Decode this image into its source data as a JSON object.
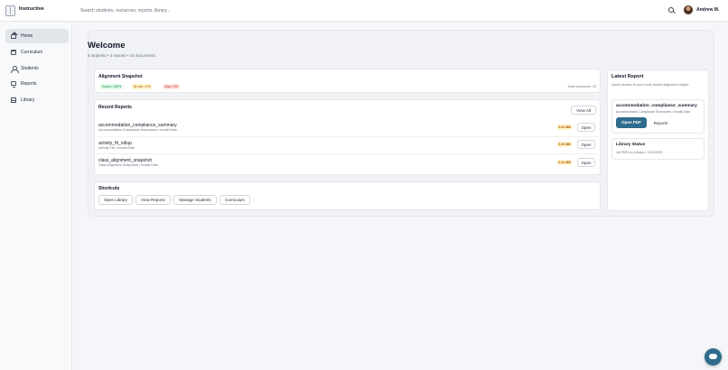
{
  "app": {
    "brand": "Instructive"
  },
  "topbar": {
    "search_placeholder": "Search students, resources, reports, library...",
    "user_name": "Andrew M."
  },
  "sidebar": {
    "items": [
      {
        "label": "Home",
        "icon": "home-icon",
        "active": true
      },
      {
        "label": "Curriculum",
        "icon": "calendar-icon"
      },
      {
        "label": "Students",
        "icon": "user-icon"
      },
      {
        "label": "Reports",
        "icon": "monitor-icon"
      },
      {
        "label": "Library",
        "icon": "library-icon"
      }
    ]
  },
  "welcome": {
    "title": "Welcome",
    "subtitle": "6 students • 3 reports • 18 documents"
  },
  "alignment": {
    "title": "Alignment Snapshot",
    "good": "Good • 100%",
    "at_risk": "At risk • 0%",
    "gap": "Gap • 0%",
    "total": "Total resources: 15"
  },
  "recent_reports": {
    "title": "Recent Reports",
    "view_all": "View All",
    "open_label": "Open",
    "rows": [
      {
        "title": "accommodation_compliance_summary",
        "sub": "Accommodation Compliance Summaries • Invalid Date",
        "size": "0.02 MB"
      },
      {
        "title": "activity_fit_rollup",
        "sub": "Activity Fits • Invalid Date",
        "size": "0.02 MB"
      },
      {
        "title": "class_alignment_snapshot",
        "sub": "Class Alignment Snapshots • Invalid Date",
        "size": "0.02 MB"
      }
    ]
  },
  "shortcuts": {
    "title": "Shortcuts",
    "buttons": [
      "Open Library",
      "View Reports",
      "Manage Students",
      "Curriculum"
    ]
  },
  "latest_report": {
    "title": "Latest Report",
    "subtitle": "Quick access to your most recent alignment output.",
    "report_title": "accommodation_compliance_summary",
    "report_sub": "Accommodation Compliance Summaries • Invalid Date",
    "open_pdf": "Open PDF",
    "reports": "Reports"
  },
  "library_status": {
    "title": "Library Status",
    "sub": "18 PDFs in Library • 11/3/2025"
  },
  "colors": {
    "accent": "#2f6b8c",
    "good": "#15803d",
    "risk": "#b45309",
    "gap": "#b91c1c"
  }
}
